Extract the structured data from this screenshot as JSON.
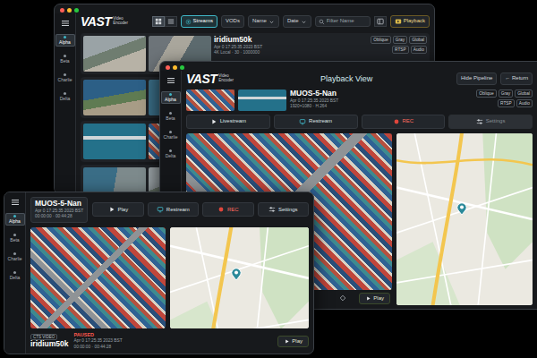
{
  "library_window": {
    "logo": {
      "brand": "VAST",
      "subtitle": "Video Encoder"
    },
    "view_modes": [
      {
        "kind": "grid",
        "selected": true
      },
      {
        "kind": "list",
        "selected": false
      }
    ],
    "filters": [
      {
        "label": "Streams",
        "selected": true
      },
      {
        "label": "VODs",
        "selected": false
      }
    ],
    "sort_menus": [
      "Name",
      "Date"
    ],
    "search": {
      "placeholder": "Filter Name"
    },
    "playback_button": "Playback",
    "sidebar": [
      {
        "label": "Alpha",
        "selected": true
      },
      {
        "label": "Beta",
        "selected": false
      },
      {
        "label": "Charlie",
        "selected": false
      },
      {
        "label": "Delta",
        "selected": false
      }
    ],
    "streams": [
      {
        "name": "iridium50k",
        "meta": [
          "Apr 0 17:25:35 2023 BST",
          "4K Local · 30 · 1000000"
        ],
        "tags": [
          "Oblique",
          "Gray",
          "Global",
          "RTSP",
          "Audio"
        ]
      }
    ]
  },
  "playback_window": {
    "logo": {
      "brand": "VAST",
      "subtitle": "Video Encoder"
    },
    "title": "Playback View",
    "header_buttons": [
      "Hide Pipeline",
      "← Return"
    ],
    "sidebar": [
      {
        "label": "Alpha",
        "selected": true
      },
      {
        "label": "Beta",
        "selected": false
      },
      {
        "label": "Charlie",
        "selected": false
      },
      {
        "label": "Delta",
        "selected": false
      }
    ],
    "stream": {
      "name": "MUOS-5-Nan",
      "meta": [
        "Apr 0 17:25:35 2023 BST",
        "1920×1080 · H.264"
      ],
      "tags": [
        "Oblique",
        "Gray",
        "Global",
        "RTSP",
        "Audio"
      ]
    },
    "actions": [
      {
        "label": "Livestream",
        "kind": "play",
        "disabled": false
      },
      {
        "label": "Restream",
        "kind": "restream",
        "disabled": false
      },
      {
        "label": "REC",
        "kind": "record",
        "disabled": false
      },
      {
        "label": "Settings",
        "kind": "settings",
        "disabled": true
      }
    ],
    "play_button": "Play"
  },
  "front_window": {
    "sidebar": [
      {
        "label": "Alpha",
        "selected": true
      },
      {
        "label": "Beta",
        "selected": false
      },
      {
        "label": "Charlie",
        "selected": false
      },
      {
        "label": "Delta",
        "selected": false
      }
    ],
    "stream": {
      "name": "MUOS-5-Nan",
      "meta": [
        "Apr 0 17:25:35 2023 BST",
        "00:00:00 · 00:44:28"
      ]
    },
    "actions": [
      {
        "label": "Play",
        "kind": "play",
        "disabled": false
      },
      {
        "label": "Restream",
        "kind": "restream",
        "disabled": false
      },
      {
        "label": "REC",
        "kind": "record",
        "disabled": false
      },
      {
        "label": "Settings",
        "kind": "settings",
        "disabled": false
      }
    ],
    "footer": {
      "badge": "CTS VIDEO",
      "name": "iridium50k",
      "status": "PAUSED",
      "meta": [
        "Apr 0 17:25:35 2023 BST",
        "00:00:00 · 00:44:28"
      ],
      "play_button": "Play"
    }
  }
}
